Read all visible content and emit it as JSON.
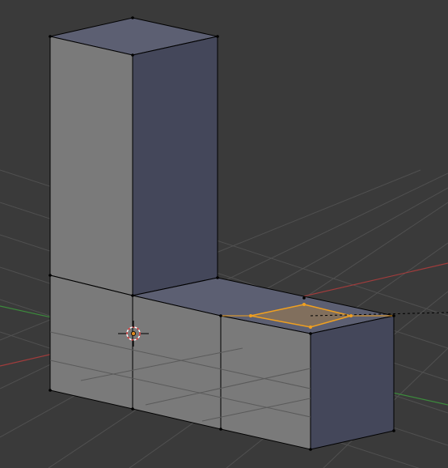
{
  "app": "3D viewport",
  "viewport": {
    "background": "#3a3a3a",
    "grid_color": "#505050",
    "x_axis_color": "#a03c3c",
    "y_axis_color": "#3c8a3c",
    "mode": "edit"
  },
  "mesh": {
    "shape": "L-shaped extrusion",
    "front_face_color": "#7a7a7a",
    "side_face_color": "#44475a",
    "top_face_color": "#5c5f72",
    "edge_color": "#000000",
    "selected_face": {
      "color": "#f0a020",
      "state": "selected"
    }
  },
  "cursor": {
    "icon": "3d-cursor-icon",
    "ring_color": "#e04040"
  },
  "origin": {
    "icon": "origin-dot-icon",
    "color": "#e08a20"
  }
}
